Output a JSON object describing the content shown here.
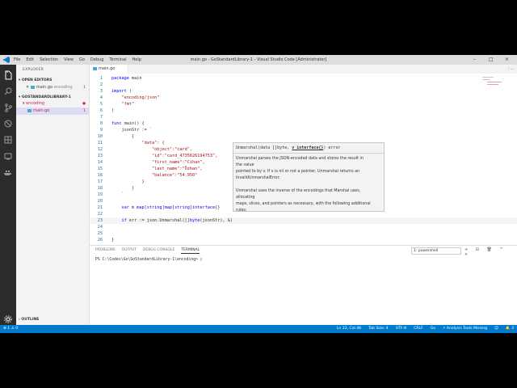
{
  "titlebar": {
    "menu": [
      "File",
      "Edit",
      "Selection",
      "View",
      "Go",
      "Debug",
      "Terminal",
      "Help"
    ],
    "window_title": "main.go - GoStandardLibrary-1 - Visual Studio Code [Administrator]",
    "controls": [
      "–",
      "□",
      "×"
    ]
  },
  "activity_icons": [
    "files-icon",
    "search-icon",
    "source-control-icon",
    "debug-icon",
    "extensions-icon",
    "remote-icon",
    "docker-icon",
    "settings-gear-icon"
  ],
  "sidebar": {
    "title": "EXPLORER",
    "open_editors_label": "OPEN EDITORS",
    "open_editor": {
      "name": "main.go",
      "path": "encoding",
      "badge": "1"
    },
    "workspace_label": "GOSTANDARDLIBRARY-1",
    "folder": {
      "name": "encoding",
      "badge": "●"
    },
    "file": {
      "name": "main.go",
      "badge": "1"
    },
    "outline_label": "OUTLINE"
  },
  "editor": {
    "tab_label": "main.go",
    "tab_actions": "⫶  ⋯",
    "lines": [
      {
        "n": "1",
        "html": "<span class='k'>package</span> main"
      },
      {
        "n": "2",
        "html": ""
      },
      {
        "n": "3",
        "html": "<span class='k'>import</span> ("
      },
      {
        "n": "4",
        "html": "    <span class='s'>\"encoding/json\"</span>"
      },
      {
        "n": "5",
        "html": "    <span class='s'>\"fmt\"</span>"
      },
      {
        "n": "6",
        "html": ")"
      },
      {
        "n": "7",
        "html": ""
      },
      {
        "n": "8",
        "html": "<span class='k'>func</span> main() {"
      },
      {
        "n": "9",
        "html": "    jsonStr := `"
      },
      {
        "n": "10",
        "html": "        {"
      },
      {
        "n": "11",
        "html": "            <span class='s'>\"data\": {</span>"
      },
      {
        "n": "12",
        "html": "                <span class='s'>\"object\":\"card\",</span>"
      },
      {
        "n": "13",
        "html": "                <span class='s'>\"id\":\"card_4735626194753\",</span>"
      },
      {
        "n": "14",
        "html": "                <span class='s'>\"first_name\":\"Cihan\",</span>"
      },
      {
        "n": "15",
        "html": "                <span class='s'>\"last_name\":\"Özhan\",</span>"
      },
      {
        "n": "16",
        "html": "                <span class='s'>\"balance\":\"54.950\"</span>"
      },
      {
        "n": "17",
        "html": "            <span class='s'>}</span>"
      },
      {
        "n": "18",
        "html": "        <span class='s'>}</span>"
      },
      {
        "n": "19",
        "html": "    `"
      },
      {
        "n": "20",
        "html": ""
      },
      {
        "n": "21",
        "html": "    <span class='k'>var</span> m <span class='k'>map</span>[<span class='k'>string</span>]<span class='k'>map</span>[<span class='k'>string</span>]<span class='k'>interface</span>{}"
      },
      {
        "n": "22",
        "html": ""
      },
      {
        "n": "23",
        "html": "    <span class='k'>if</span> err := json.Unmarshal([]<span class='k'>byte</span>(jsonStr), &amp;)"
      },
      {
        "n": "24",
        "html": ""
      },
      {
        "n": "25",
        "html": ""
      },
      {
        "n": "26",
        "html": "}"
      }
    ]
  },
  "hover": {
    "sig_prefix": "Unmarshal(data []byte, ",
    "sig_param": "v interface{}",
    "sig_suffix": ") error",
    "doc_lines": [
      "Unmarshal parses the JSON-encoded data and stores the result in",
      "the value",
      "pointed to by v. If v is nil or not a pointer, Unmarshal returns an",
      "InvalidUnmarshalError.",
      "",
      "Unmarshal uses the inverse of the encodings that Marshal uses,",
      "allocating",
      "maps, slices, and pointers as necessary, with the following additional",
      "rules:"
    ]
  },
  "panel": {
    "tabs": [
      "PROBLEMS",
      "OUTPUT",
      "DEBUG CONSOLE",
      "TERMINAL"
    ],
    "active_tab": "TERMINAL",
    "terminal_select": "1: powershell",
    "terminal_actions": "+ ⊟ 🗑 ^ ×",
    "terminal_line": "PS C:\\Codes\\Go\\GoStandardLibrary-1\\encoding> ▯"
  },
  "statusbar": {
    "left": "⊗ 1 ⚠ 0",
    "items": [
      "Ln 23, Col 48",
      "Tab Size: 4",
      "UTF-8",
      "CRLF",
      "Go",
      "⚡ Analysis Tools Missing",
      "☺",
      "🔔 3"
    ]
  },
  "colors": {
    "activity": "#2c2c2c",
    "statusbar": "#007acc",
    "keyword": "#0000ff",
    "string": "#a31515"
  }
}
